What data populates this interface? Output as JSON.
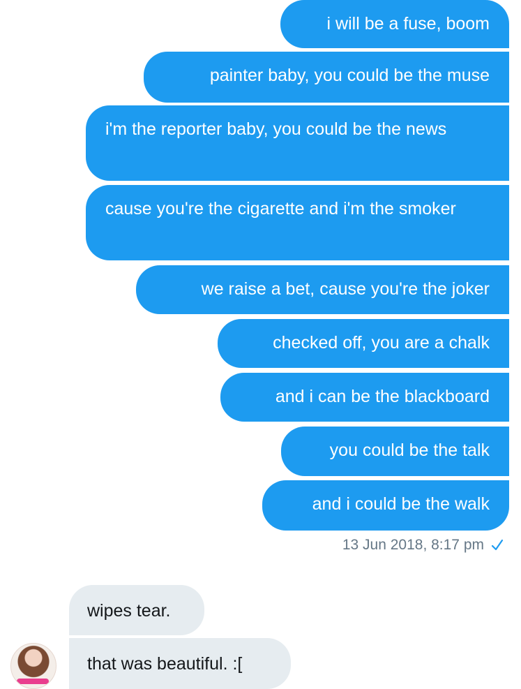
{
  "outgoing_messages": [
    "i will be a fuse, boom",
    "painter baby, you could be the muse",
    "i'm the reporter baby, you could be the news",
    "cause you're the cigarette and i'm the smoker",
    "we raise a bet, cause you're the joker",
    "checked off, you are a chalk",
    "and i can be the blackboard",
    "you could be the talk",
    "and i could be the walk"
  ],
  "timestamp": "13 Jun 2018, 8:17 pm",
  "status_icon": "check-icon",
  "incoming_messages": [
    "wipes tear.",
    "that was beautiful. :["
  ],
  "colors": {
    "outgoing_bubble": "#1d9bf0",
    "incoming_bubble": "#e6ecf0",
    "outgoing_text": "#ffffff",
    "incoming_text": "#14171a",
    "timestamp_text": "#657786",
    "check": "#1d9bf0"
  }
}
